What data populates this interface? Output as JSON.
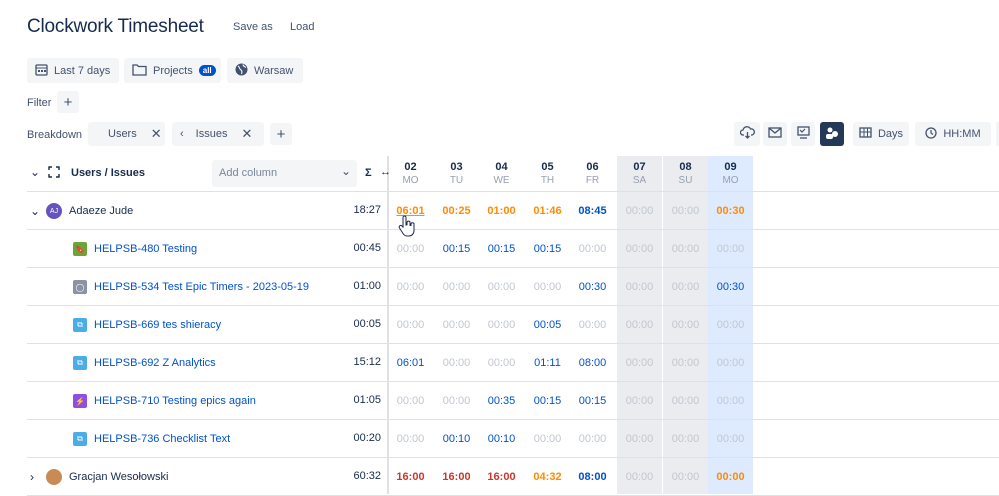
{
  "app": {
    "title": "Clockwork Timesheet",
    "save_as": "Save as",
    "load": "Load"
  },
  "chips": {
    "period": "Last 7 days",
    "projects": "Projects",
    "projects_badge": "all",
    "timezone": "Warsaw"
  },
  "filter": {
    "label": "Filter"
  },
  "breakdown": {
    "label": "Breakdown",
    "items": [
      "Users",
      "Issues"
    ]
  },
  "toolbar": {
    "days": "Days",
    "format": "HH:MM"
  },
  "table": {
    "header": "Users / Issues",
    "add_column_placeholder": "Add column",
    "sigma": "Σ",
    "days": [
      {
        "n": "02",
        "d": "MO"
      },
      {
        "n": "03",
        "d": "TU"
      },
      {
        "n": "04",
        "d": "WE"
      },
      {
        "n": "05",
        "d": "TH"
      },
      {
        "n": "06",
        "d": "FR"
      },
      {
        "n": "07",
        "d": "SA"
      },
      {
        "n": "08",
        "d": "SU"
      },
      {
        "n": "09",
        "d": "MO"
      }
    ],
    "rows": [
      {
        "kind": "user",
        "avatar": "AJ",
        "name": "Adaeze Jude",
        "total": "18:27",
        "vals": [
          "06:01",
          "00:25",
          "01:00",
          "01:46",
          "08:45",
          "00:00",
          "00:00",
          "00:30"
        ],
        "cls": [
          "co",
          "co",
          "co",
          "co",
          "cb",
          "c0",
          "c0",
          "co"
        ]
      },
      {
        "kind": "issue",
        "icon": "story",
        "name": "HELPSB-480 Testing",
        "total": "00:45",
        "vals": [
          "00:00",
          "00:15",
          "00:15",
          "00:15",
          "00:00",
          "00:00",
          "00:00",
          "00:00"
        ],
        "cls": [
          "c0",
          "cb",
          "cb",
          "cb",
          "c0",
          "c0",
          "c0",
          "c0"
        ]
      },
      {
        "kind": "issue",
        "icon": "epic-timer",
        "name": "HELPSB-534 Test Epic Timers - 2023-05-19",
        "total": "01:00",
        "vals": [
          "00:00",
          "00:00",
          "00:00",
          "00:00",
          "00:30",
          "00:00",
          "00:00",
          "00:30"
        ],
        "cls": [
          "c0",
          "c0",
          "c0",
          "c0",
          "cb",
          "c0",
          "c0",
          "cb"
        ]
      },
      {
        "kind": "issue",
        "icon": "subtask",
        "name": "HELPSB-669 tes shieracy",
        "total": "00:05",
        "vals": [
          "00:00",
          "00:00",
          "00:00",
          "00:05",
          "00:00",
          "00:00",
          "00:00",
          "00:00"
        ],
        "cls": [
          "c0",
          "c0",
          "c0",
          "cb",
          "c0",
          "c0",
          "c0",
          "c0"
        ]
      },
      {
        "kind": "issue",
        "icon": "subtask",
        "name": "HELPSB-692 Z Analytics",
        "total": "15:12",
        "vals": [
          "06:01",
          "00:00",
          "00:00",
          "01:11",
          "08:00",
          "00:00",
          "00:00",
          "00:00"
        ],
        "cls": [
          "cb",
          "c0",
          "c0",
          "cb",
          "cb",
          "c0",
          "c0",
          "c0"
        ]
      },
      {
        "kind": "issue",
        "icon": "epic",
        "name": "HELPSB-710 Testing epics again",
        "total": "01:05",
        "vals": [
          "00:00",
          "00:00",
          "00:35",
          "00:15",
          "00:15",
          "00:00",
          "00:00",
          "00:00"
        ],
        "cls": [
          "c0",
          "c0",
          "cb",
          "cb",
          "cb",
          "c0",
          "c0",
          "c0"
        ]
      },
      {
        "kind": "issue",
        "icon": "subtask",
        "name": "HELPSB-736 Checklist Text",
        "total": "00:20",
        "vals": [
          "00:00",
          "00:10",
          "00:10",
          "00:00",
          "00:00",
          "00:00",
          "00:00",
          "00:00"
        ],
        "cls": [
          "c0",
          "cb",
          "cb",
          "c0",
          "c0",
          "c0",
          "c0",
          "c0"
        ]
      },
      {
        "kind": "user",
        "avatar": "photo",
        "name": "Gracjan Wesołowski",
        "total": "60:32",
        "vals": [
          "16:00",
          "16:00",
          "16:00",
          "04:32",
          "08:00",
          "00:00",
          "00:00",
          "00:00"
        ],
        "cls": [
          "cr",
          "cr",
          "cr",
          "co",
          "cb",
          "c0",
          "c0",
          "co"
        ]
      }
    ]
  }
}
